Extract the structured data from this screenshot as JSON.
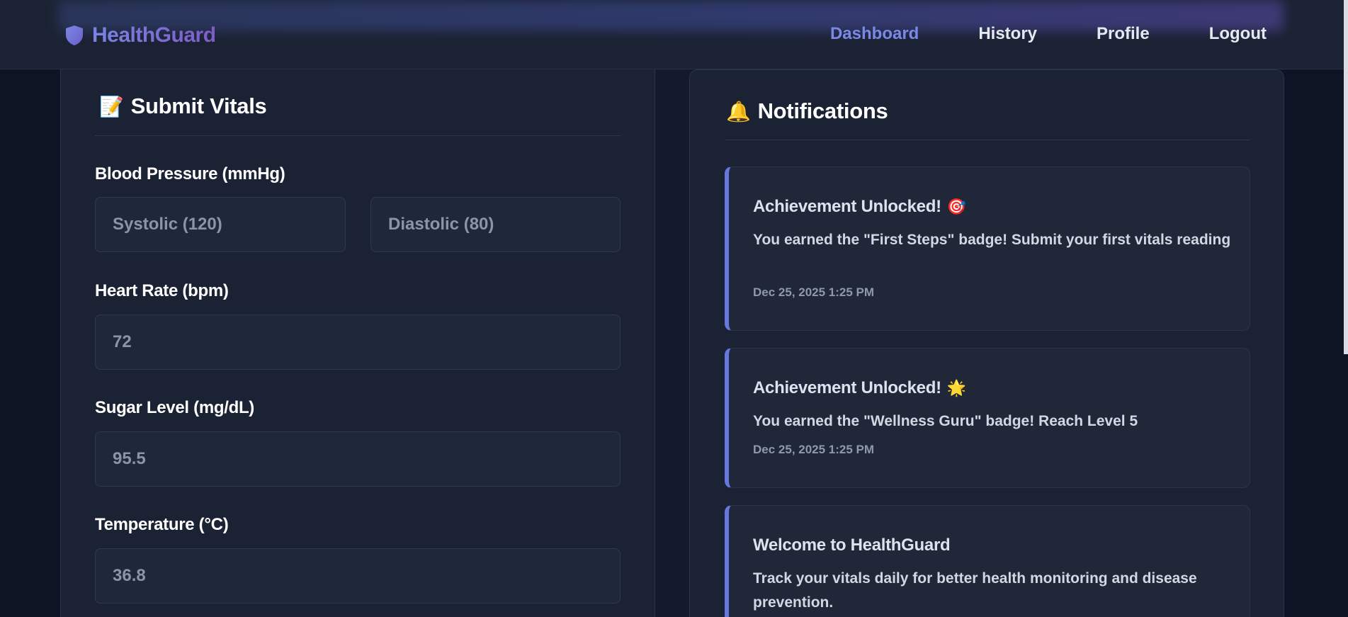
{
  "brand": {
    "name": "HealthGuard",
    "icon": "shield-icon"
  },
  "nav": {
    "items": [
      {
        "label": "Dashboard",
        "active": true
      },
      {
        "label": "History",
        "active": false
      },
      {
        "label": "Profile",
        "active": false
      },
      {
        "label": "Logout",
        "active": false
      }
    ]
  },
  "vitals": {
    "title": "Submit Vitals",
    "title_icon": "📝",
    "bp": {
      "label": "Blood Pressure (mmHg)",
      "systolic_placeholder": "Systolic (120)",
      "diastolic_placeholder": "Diastolic (80)"
    },
    "heart_rate": {
      "label": "Heart Rate (bpm)",
      "placeholder": "72"
    },
    "sugar": {
      "label": "Sugar Level (mg/dL)",
      "placeholder": "95.5"
    },
    "temperature": {
      "label": "Temperature (°C)",
      "placeholder": "36.8"
    }
  },
  "notifications": {
    "title": "Notifications",
    "title_icon": "🔔",
    "items": [
      {
        "title": "Achievement Unlocked!",
        "emoji": "🎯",
        "message": "You earned the \"First Steps\" badge! Submit your first vitals reading",
        "time": "Dec 25, 2025 1:25 PM"
      },
      {
        "title": "Achievement Unlocked!",
        "emoji": "🌟",
        "message": "You earned the \"Wellness Guru\" badge! Reach Level 5",
        "time": "Dec 25, 2025 1:25 PM"
      },
      {
        "title": "Welcome to HealthGuard",
        "emoji": "",
        "message": "Track your vitals daily for better health monitoring and disease prevention.",
        "time": ""
      }
    ]
  },
  "colors": {
    "accent": "#6877e0",
    "brand_gradient_start": "#7b84e3",
    "brand_gradient_end": "#7d5cc6",
    "background": "#111827",
    "card": "#1b2234"
  }
}
